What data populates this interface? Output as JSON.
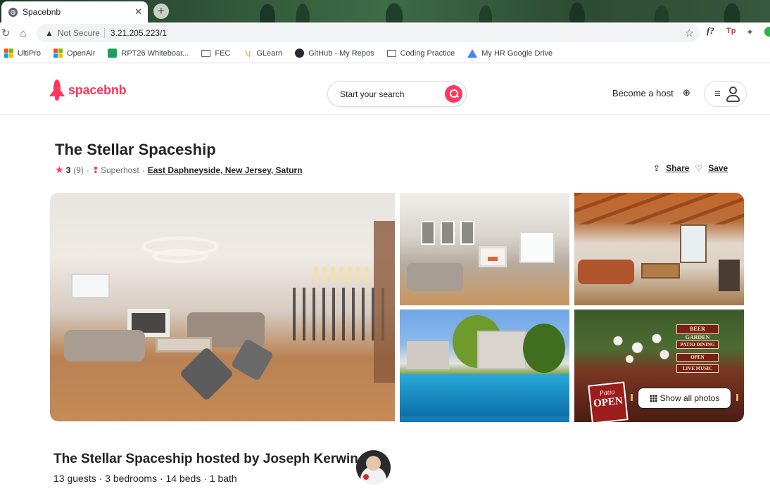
{
  "browser": {
    "tab_title": "Spacebnb",
    "tab_close": "✕",
    "new_tab": "+",
    "security_label": "Not Secure",
    "url": "3.21.205.223/1",
    "extensions": [
      "f?",
      "Tp"
    ],
    "bookmarks": [
      {
        "label": "UltiPro",
        "icon": "windows-icon"
      },
      {
        "label": "OpenAir",
        "icon": "windows-icon"
      },
      {
        "label": "RPT26 Whiteboar...",
        "icon": "trello-icon"
      },
      {
        "label": "FEC",
        "icon": "folder-icon"
      },
      {
        "label": "GLearn",
        "icon": "glearn-icon"
      },
      {
        "label": "GitHub - My Repos",
        "icon": "github-icon"
      },
      {
        "label": "Coding Practice",
        "icon": "folder-icon"
      },
      {
        "label": "My HR Google Drive",
        "icon": "drive-icon"
      }
    ]
  },
  "header": {
    "logo_text": "spacebnb",
    "search_placeholder": "Start your search",
    "become_host": "Become a host",
    "brand_color": "#ff385c"
  },
  "listing": {
    "title": "The Stellar Spaceship",
    "rating": "3",
    "review_count": "(9)",
    "separator": "·",
    "superhost": "Superhost",
    "location": "East Daphneyside, New Jersey, Saturn",
    "share_label": "Share",
    "save_label": "Save",
    "show_all_photos": "Show all photos"
  },
  "photos": {
    "sign_beer_garden": "BEER GARDEN",
    "sign_patio_dining": "PATIO DINING",
    "sign_open": "OPEN",
    "sign_live_music": "LIVE MUSIC",
    "open_sign_top": "Patio",
    "open_sign_bottom": "OPEN"
  },
  "host": {
    "heading": "The Stellar Spaceship hosted by Joseph Kerwin",
    "details": "13 guests · 3 bedrooms · 14 beds · 1 bath"
  }
}
